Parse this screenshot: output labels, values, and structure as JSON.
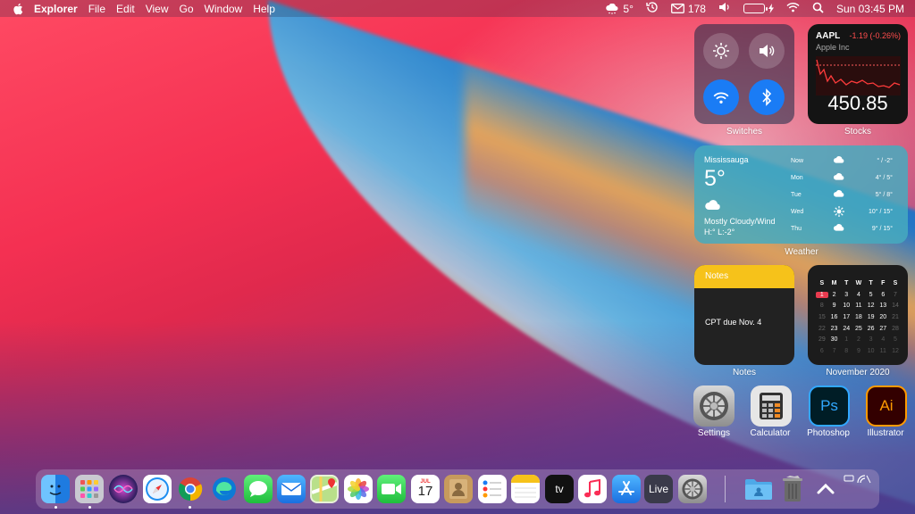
{
  "menubar": {
    "app_name": "Explorer",
    "menus": [
      "File",
      "Edit",
      "View",
      "Go",
      "Window",
      "Help"
    ],
    "weather_temp": "5°",
    "mail_count": "178",
    "clock": "Sun 03:45 PM"
  },
  "switches": {
    "label": "Switches"
  },
  "stocks": {
    "symbol": "AAPL",
    "change": "-1.19 (-0.26%)",
    "company": "Apple Inc",
    "price": "450.85",
    "label": "Stocks",
    "change_color": "#ff4d4d"
  },
  "weather": {
    "city": "Mississauga",
    "temp": "5°",
    "condition": "Mostly Cloudy/Wind",
    "hilo": "H:° L:-2°",
    "label": "Weather",
    "forecast": [
      {
        "day": "Now",
        "icon": "cloud-icon",
        "range": "° / -2°"
      },
      {
        "day": "Mon",
        "icon": "cloud-icon",
        "range": "4° / 5°"
      },
      {
        "day": "Tue",
        "icon": "cloud-icon",
        "range": "5° / 8°"
      },
      {
        "day": "Wed",
        "icon": "sun-icon",
        "range": "10° / 15°"
      },
      {
        "day": "Thu",
        "icon": "cloud-icon",
        "range": "9° / 15°"
      }
    ]
  },
  "notes": {
    "header": "Notes",
    "text": "CPT due Nov. 4",
    "label": "Notes"
  },
  "calendar": {
    "label": "November 2020",
    "headers": [
      "S",
      "M",
      "T",
      "W",
      "T",
      "F",
      "S"
    ],
    "days": [
      "1",
      "2",
      "3",
      "4",
      "5",
      "6",
      "7",
      "8",
      "9",
      "10",
      "11",
      "12",
      "13",
      "14",
      "15",
      "16",
      "17",
      "18",
      "19",
      "20",
      "21",
      "22",
      "23",
      "24",
      "25",
      "26",
      "27",
      "28",
      "29",
      "30",
      "1",
      "2",
      "3",
      "4",
      "5",
      "6",
      "7",
      "8",
      "9",
      "10",
      "11",
      "12"
    ],
    "today": "1"
  },
  "apps": [
    {
      "name": "Settings"
    },
    {
      "name": "Calculator"
    },
    {
      "name": "Photoshop",
      "glyph": "Ps"
    },
    {
      "name": "Illustrator",
      "glyph": "Ai"
    }
  ],
  "dock": {
    "calendar_month": "JUL",
    "calendar_day": "17",
    "tv_label": "tv",
    "live_label": "Live"
  }
}
